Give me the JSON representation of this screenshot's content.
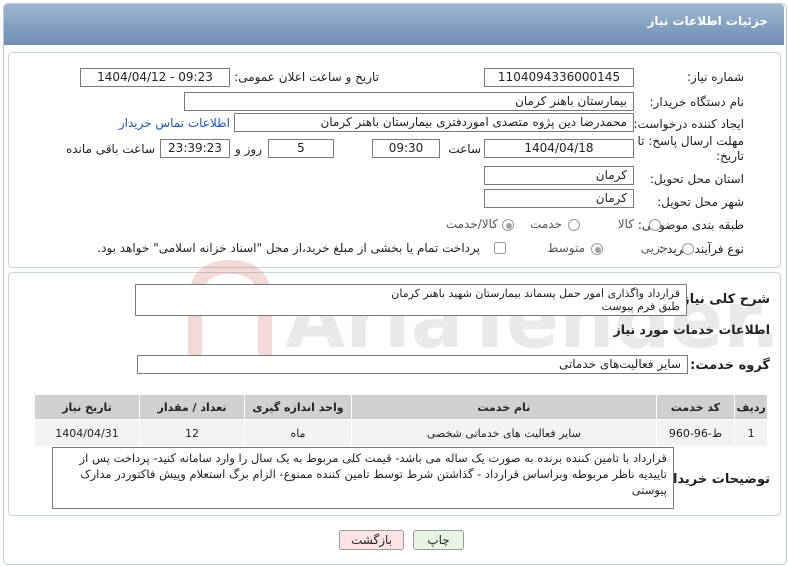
{
  "header": {
    "title": "جزئیات اطلاعات نیاز"
  },
  "form": {
    "need_number_label": "شماره نیاز:",
    "need_number": "1104094336000145",
    "announce_label": "تاریخ و ساعت اعلان عمومی:",
    "announce_value": "1404/04/12 - 09:23",
    "buyer_org_label": "نام دستگاه خریدار:",
    "buyer_org": "بیمارستان باهنر کرمان",
    "requester_label": "ایجاد کننده درخواست:",
    "requester": "محمدرضا  دین پژوه متصدی اموردفتری بیمارستان باهنر کرمان",
    "contact_link": "اطلاعات تماس خریدار",
    "deadline_label": "مهلت ارسال پاسخ: تا تاریخ:",
    "deadline_date": "1404/04/18",
    "time_label": "ساعت",
    "deadline_time": "09:30",
    "days_value": "5",
    "days_label": "روز و",
    "remaining_time": "23:39:23",
    "remaining_label": "ساعت باقی مانده",
    "province_label": "استان محل تحویل:",
    "province": "کرمان",
    "city_label": "شهر محل تحویل:",
    "city": "کرمان",
    "category_label": "طبقه بندی موضوعی:",
    "category_options": [
      "کالا",
      "خدمت",
      "کالا/خدمت"
    ],
    "category_selected": 1,
    "process_label": "نوع فرآیند خرید :",
    "process_options": [
      "جزیی",
      "متوسط"
    ],
    "process_selected": 1,
    "payment_text": "پرداخت تمام یا بخشی از مبلغ خرید،از محل \"اسناد خزانه اسلامی\" خواهد بود."
  },
  "description": {
    "label": "شرح کلی نیاز:",
    "line1": "قرارداد  واگذاری امور حمل پسماند بیمارستان شهید باهنر کرمان",
    "line2": "طبق فرم پیوست"
  },
  "services": {
    "section_title": "اطلاعات خدمات مورد نیاز",
    "group_label": "گروه خدمت:",
    "group_value": "سایر فعالیت‌های خدماتی",
    "columns": [
      "ردیف",
      "کد خدمت",
      "نام خدمت",
      "واحد اندازه گیری",
      "تعداد / مقدار",
      "تاریخ نیاز"
    ],
    "rows": [
      {
        "row": "1",
        "code": "ط-96-960",
        "name": "سایر فعالیت های خدماتی شخصی",
        "unit": "ماه",
        "qty": "12",
        "date": "1404/04/31"
      }
    ]
  },
  "buyer_notes": {
    "label": "توضیحات خریدار:",
    "text": "قرارداد با تامین کننده برنده به صورت یک ساله می باشد- قیمت کلی مربوط به یک سال را وارد سامانه کنید- پرداخت پس از تاییدیه ناظر مربوطه وبراساس قرارداد - گذاشتن شرط توسط تامین کننده ممنوع- الزام برگ استعلام وپیش فاکتوردر مدارک پیوستی"
  },
  "buttons": {
    "print": "چاپ",
    "back": "بازگشت"
  },
  "watermark": {
    "text": "AriaTender.neT"
  },
  "colors": {
    "header": "#7f9cc0",
    "link": "#1a57b4",
    "print_btn": "#e8f5e2",
    "back_btn": "#fde3e3"
  }
}
